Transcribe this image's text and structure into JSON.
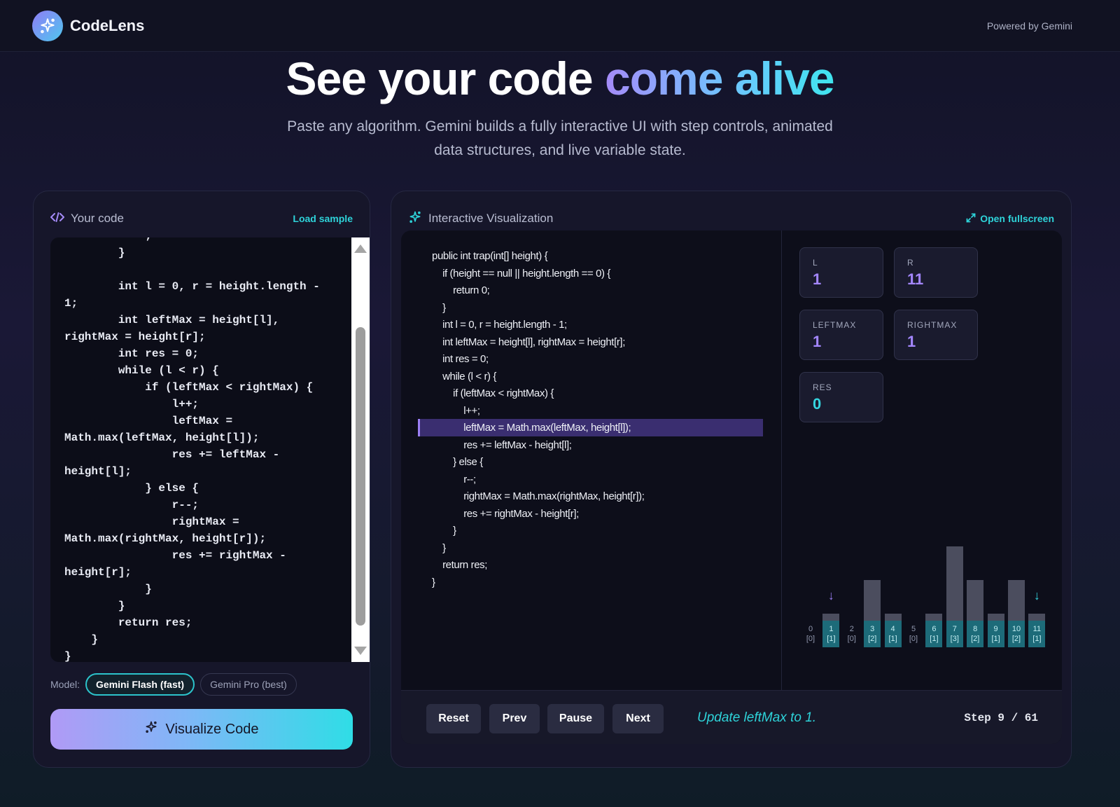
{
  "app": {
    "name": "CodeLens",
    "powered_by": "Powered by Gemini"
  },
  "hero": {
    "title_main": "See your code ",
    "title_accent": "come alive",
    "subtitle": "Paste any algorithm. Gemini builds a fully interactive UI with step controls, animated data structures, and live variable state."
  },
  "editor_panel": {
    "title": "Your code",
    "load_sample": "Load sample",
    "code": "            ;\n        }\n\n        int l = 0, r = height.length -\n1;\n        int leftMax = height[l],\nrightMax = height[r];\n        int res = 0;\n        while (l < r) {\n            if (leftMax < rightMax) {\n                l++;\n                leftMax =\nMath.max(leftMax, height[l]);\n                res += leftMax -\nheight[l];\n            } else {\n                r--;\n                rightMax =\nMath.max(rightMax, height[r]);\n                res += rightMax -\nheight[r];\n            }\n        }\n        return res;\n    }\n}",
    "model_label": "Model:",
    "models": [
      "Gemini Flash (fast)",
      "Gemini Pro (best)"
    ],
    "visualize_button": "Visualize Code"
  },
  "viz_panel": {
    "title": "Interactive Visualization",
    "fullscreen": "Open fullscreen",
    "code_lines": [
      "public int trap(int[] height) {",
      "    if (height == null || height.length == 0) {",
      "        return 0;",
      "    }",
      "    int l = 0, r = height.length - 1;",
      "    int leftMax = height[l], rightMax = height[r];",
      "    int res = 0;",
      "    while (l < r) {",
      "        if (leftMax < rightMax) {",
      "            l++;",
      "            leftMax = Math.max(leftMax, height[l]);",
      "            res += leftMax - height[l];",
      "        } else {",
      "            r--;",
      "            rightMax = Math.max(rightMax, height[r]);",
      "            res += rightMax - height[r];",
      "        }",
      "    }",
      "    return res;",
      "}"
    ],
    "highlight_line_index": 10,
    "variables": [
      {
        "name": "L",
        "value": "1",
        "color": "#a487ff"
      },
      {
        "name": "R",
        "value": "11",
        "color": "#a487ff"
      },
      {
        "name": "LEFTMAX",
        "value": "1",
        "color": "#a487ff"
      },
      {
        "name": "RIGHTMAX",
        "value": "1",
        "color": "#a487ff"
      },
      {
        "name": "RES",
        "value": "0",
        "color": "#35d6e0"
      }
    ],
    "array": {
      "heights": [
        0,
        1,
        0,
        2,
        1,
        0,
        1,
        3,
        2,
        1,
        2,
        1
      ],
      "indices": [
        "0",
        "1",
        "2",
        "3",
        "4",
        "5",
        "6",
        "7",
        "8",
        "9",
        "10",
        "11"
      ],
      "sub_labels": [
        "[0]",
        "[1]",
        "[0]",
        "[2]",
        "[1]",
        "[0]",
        "[1]",
        "[3]",
        "[2]",
        "[1]",
        "[2]",
        "[1]"
      ],
      "water_level": 1,
      "left_pointer": 1,
      "right_pointer": 11,
      "left_pointer_color": "#9b7ff5",
      "right_pointer_color": "#35d6e0"
    },
    "controls": {
      "reset": "Reset",
      "prev": "Prev",
      "pause": "Pause",
      "next": "Next"
    },
    "step_message": "Update leftMax to 1.",
    "step_label": "Step",
    "step_current": "9",
    "step_total": "61"
  },
  "colors": {
    "accent_cyan": "#2ed3d9",
    "accent_purple": "#9b7ff5",
    "panel_bg": "#16162a"
  }
}
